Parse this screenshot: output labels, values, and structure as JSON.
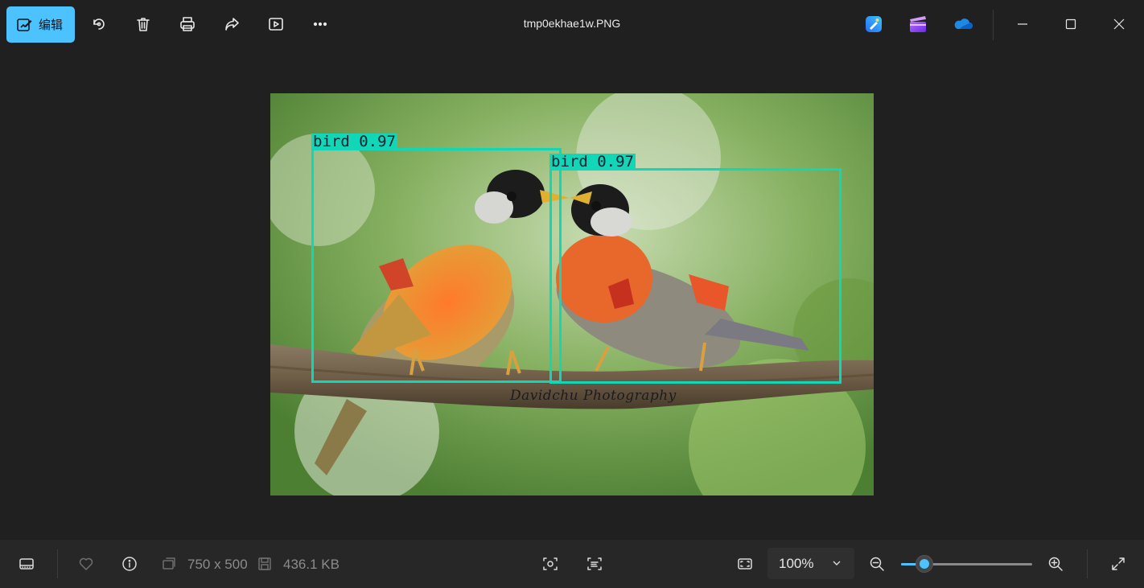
{
  "toolbar": {
    "edit_label": "编辑",
    "accent_color": "#4cc2ff",
    "tools": [
      "rotate-icon",
      "delete-icon",
      "print-icon",
      "share-icon",
      "slideshow-icon",
      "more-icon"
    ]
  },
  "window": {
    "title": "tmp0ekhae1w.PNG",
    "app_icons": [
      "designer-icon",
      "clipchamp-icon",
      "onedrive-icon"
    ],
    "controls": [
      "minimize-icon",
      "maximize-icon",
      "close-icon"
    ]
  },
  "image": {
    "detections": [
      {
        "label": "bird 0.97"
      },
      {
        "label": "bird 0.97"
      }
    ],
    "box_color": "#12d6b8",
    "watermark": "Davidchu Photography"
  },
  "bottombar": {
    "dimensions": "750 x 500",
    "file_size": "436.1 KB",
    "zoom": "100%",
    "zoom_level_fraction": 0.18
  }
}
